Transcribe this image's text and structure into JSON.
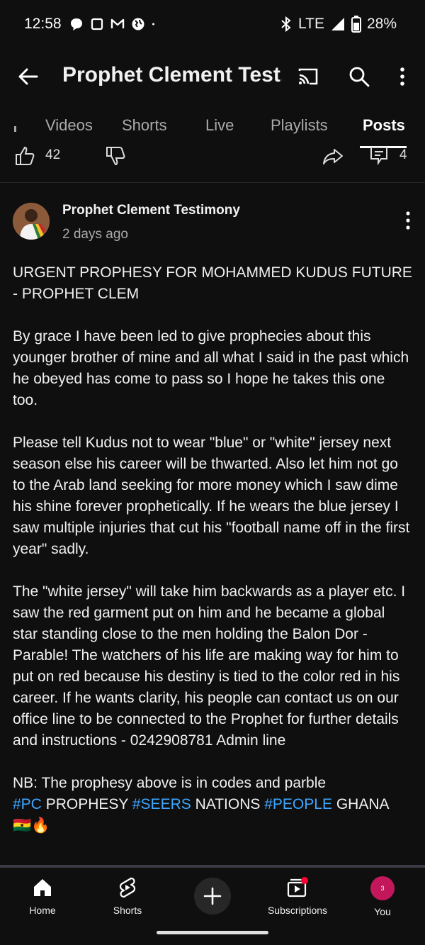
{
  "status_bar": {
    "time": "12:58",
    "network": "LTE",
    "battery": "28%",
    "left_icons": [
      "chat-bubble-icon",
      "square-icon",
      "gmail-icon",
      "globe-icon",
      "dot-icon"
    ],
    "right_icons": [
      "bluetooth-icon",
      "signal-icon",
      "battery-icon"
    ]
  },
  "app_bar": {
    "title": "Prophet Clement Test..."
  },
  "tabs": {
    "items": [
      "Videos",
      "Shorts",
      "Live",
      "Playlists",
      "Posts"
    ],
    "active": "Posts"
  },
  "previous_post": {
    "likes": "42",
    "comments": "4"
  },
  "post": {
    "channel_name": "Prophet Clement Testimony",
    "time_ago": "2 days ago",
    "heading": "URGENT PROPHESY FOR MOHAMMED KUDUS FUTURE - PROPHET CLEM",
    "paragraph_1": "By grace I have been led to give prophecies about this younger brother of mine and all what I said in the past which he obeyed has come to pass so I hope he takes this one too.",
    "paragraph_2": "Please tell Kudus not to wear \"blue\" or \"white\" jersey next season else his career will be thwarted. Also let him not go to the Arab land seeking for more money which I saw dime his shine forever prophetically. If he wears the blue jersey I saw multiple injuries that cut his \"football name off in the first year\" sadly.",
    "paragraph_3": "The \"white jersey\" will take him backwards as a player etc. I saw the red garment put on him and he became a global star standing close to the men holding the Balon Dor - Parable! The watchers of his life are making way for him to put on red because his destiny is tied to the color red in his career. If he wants clarity, his people can contact us on our office line to be connected to the Prophet for further details and instructions - 0242908781 Admin line",
    "nb_text": "NB: The prophesy above is in codes and parble",
    "hashtag_1": "#PC",
    "word_1": "PROPHESY",
    "hashtag_2": "#SEERS",
    "word_2": "NATIONS",
    "hashtag_3": "#PEOPLE",
    "word_3": "GHANA",
    "emojis": "🇬🇭🔥"
  },
  "bottom_nav": {
    "home": "Home",
    "shorts": "Shorts",
    "subscriptions": "Subscriptions",
    "you": "You",
    "you_badge": "3"
  },
  "colors": {
    "background": "#0f0f0f",
    "hashtag": "#3ea6ff",
    "notification_dot": "#ff0033"
  }
}
